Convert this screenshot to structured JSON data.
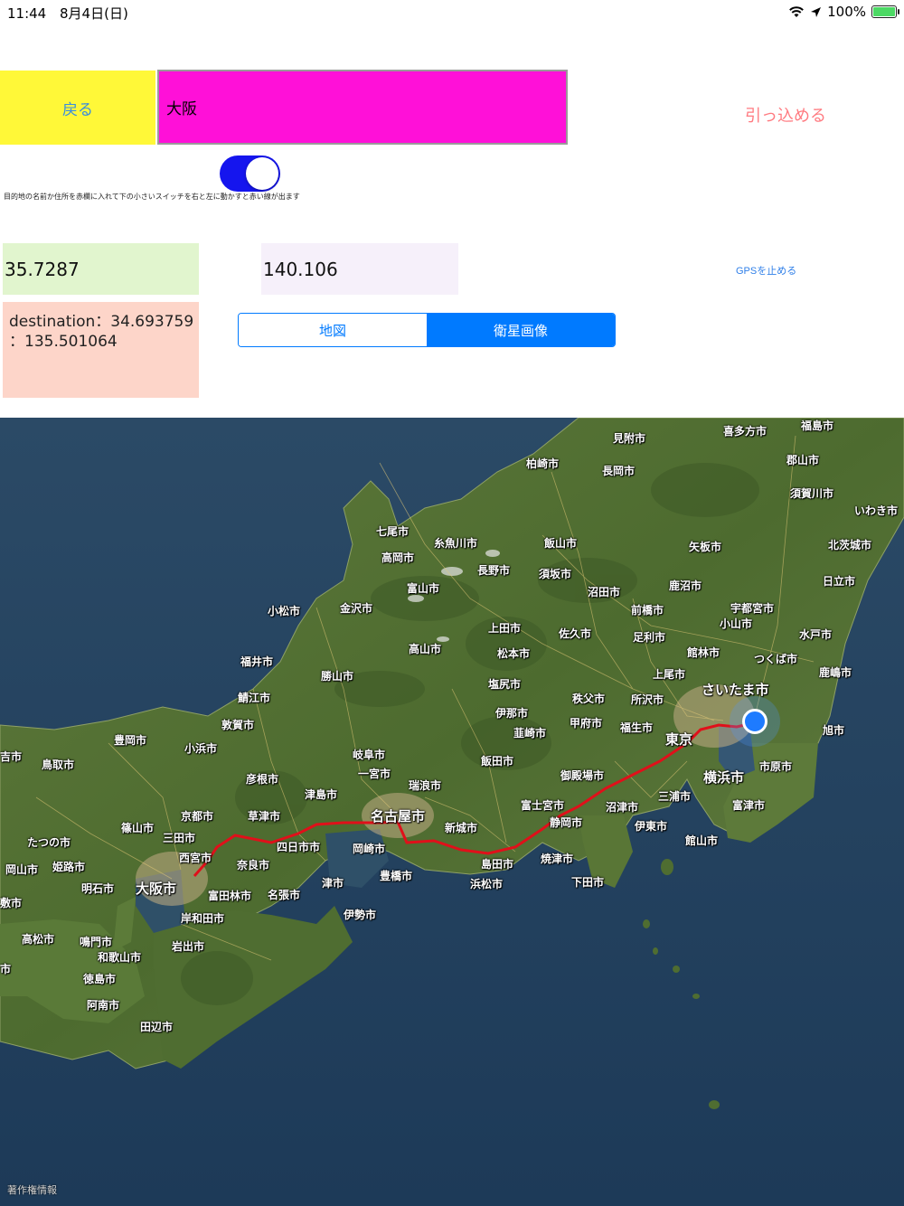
{
  "status_bar": {
    "time": "11:44",
    "date": "8月4日(日)",
    "battery": "100%",
    "battery_level": 1.0
  },
  "header": {
    "back_label": "戻る",
    "destination_value": "大阪",
    "retract_label": "引っ込める"
  },
  "toggle": {
    "on": true,
    "hint": "目的地の名前か住所を赤欄に入れて下の小さいスイッチを右と左に動かすと赤い線が出ます"
  },
  "coords": {
    "latitude": "35.7287",
    "longitude": "140.106",
    "gps_stop_label": "GPSを止める"
  },
  "destination": {
    "line1": "destination：34.693759",
    "line2": "：135.501064"
  },
  "segment": {
    "map_label": "地図",
    "satellite_label": "衛星画像",
    "selected": "衛星画像"
  },
  "map": {
    "copyright": "著作権情報",
    "route_color": "#e0101a",
    "cities": [
      "福島市",
      "喜多方市",
      "見附市",
      "柏崎市",
      "長岡市",
      "郡山市",
      "須賀川市",
      "いわき市",
      "七尾市",
      "糸魚川市",
      "飯山市",
      "矢板市",
      "北茨城市",
      "高岡市",
      "長野市",
      "須坂市",
      "鹿沼市",
      "日立市",
      "富山市",
      "沼田市",
      "宇都宮市",
      "小松市",
      "金沢市",
      "前橋市",
      "小山市",
      "水戸市",
      "上田市",
      "佐久市",
      "足利市",
      "つくば市",
      "福井市",
      "高山市",
      "松本市",
      "館林市",
      "上尾市",
      "鹿嶋市",
      "勝山市",
      "塩尻市",
      "さいたま市",
      "鯖江市",
      "秩父市",
      "所沢市",
      "伊那市",
      "甲府市",
      "福生市",
      "旭市",
      "敦賀市",
      "韮崎市",
      "東京",
      "豊岡市",
      "小浜市",
      "岐阜市",
      "飯田市",
      "吉市",
      "鳥取市",
      "一宮市",
      "彦根市",
      "瑞浪市",
      "御殿場市",
      "市原市",
      "横浜市",
      "津島市",
      "名古屋市",
      "富士宮市",
      "三浦市",
      "富津市",
      "京都市",
      "草津市",
      "新城市",
      "静岡市",
      "沼津市",
      "伊東市",
      "篠山市",
      "三田市",
      "館山市",
      "たつの市",
      "四日市市",
      "岡崎市",
      "西宮市",
      "奈良市",
      "焼津市",
      "岡山市",
      "姫路市",
      "津市",
      "豊橋市",
      "島田市",
      "下田市",
      "明石市",
      "大阪市",
      "浜松市",
      "富田林市",
      "名張市",
      "敷市",
      "岸和田市",
      "伊勢市",
      "高松市",
      "鳴門市",
      "岩出市",
      "市",
      "和歌山市",
      "徳島市",
      "阿南市",
      "田辺市"
    ]
  }
}
